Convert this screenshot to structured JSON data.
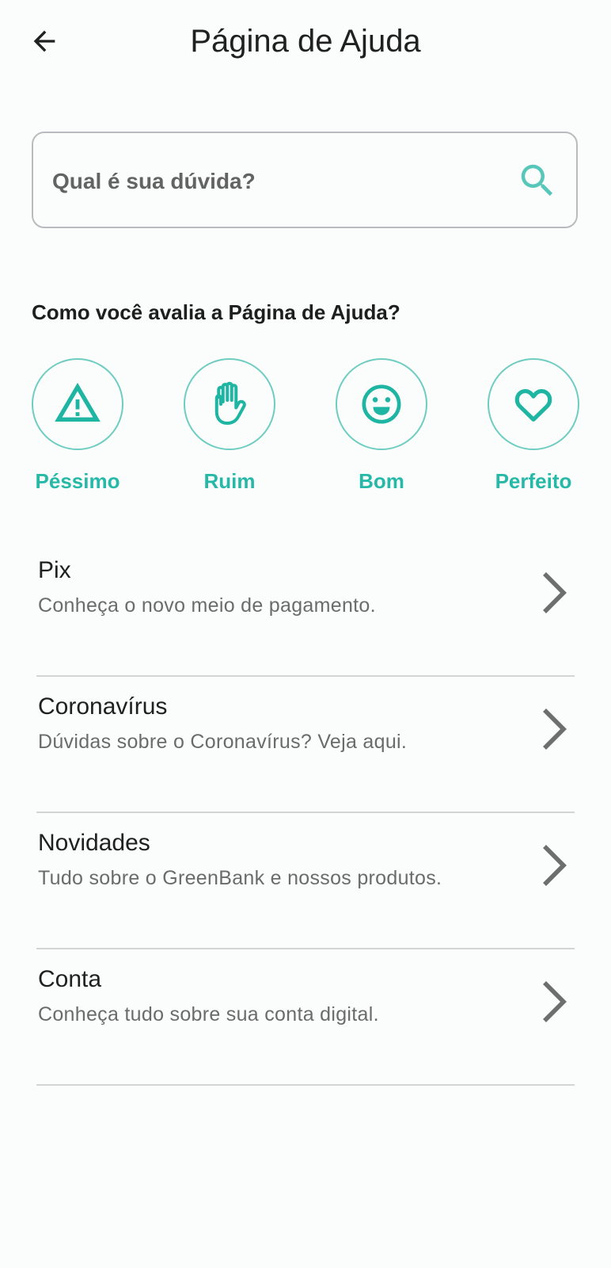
{
  "header": {
    "title": "Página de Ajuda",
    "back_icon": "arrow-left-icon"
  },
  "search": {
    "placeholder": "Qual é sua dúvida?",
    "value": "",
    "icon": "search-icon",
    "icon_color": "#56c7b8"
  },
  "rating": {
    "question": "Como você avalia a Página de Ajuda?",
    "accent_color": "#26b9a8",
    "options": [
      {
        "label": "Péssimo",
        "icon": "warning-triangle-icon"
      },
      {
        "label": "Ruim",
        "icon": "hand-stop-icon"
      },
      {
        "label": "Bom",
        "icon": "smiley-face-icon"
      },
      {
        "label": "Perfeito",
        "icon": "heart-icon"
      }
    ]
  },
  "help_topics": [
    {
      "title": "Pix",
      "subtitle": "Conheça o novo meio de pagamento.",
      "icon": "chevron-right-icon"
    },
    {
      "title": "Coronavírus",
      "subtitle": "Dúvidas sobre o Coronavírus? Veja aqui.",
      "icon": "chevron-right-icon"
    },
    {
      "title": "Novidades",
      "subtitle": "Tudo sobre o GreenBank e nossos produtos.",
      "icon": "chevron-right-icon"
    },
    {
      "title": "Conta",
      "subtitle": "Conheça tudo sobre sua conta digital.",
      "icon": "chevron-right-icon"
    }
  ]
}
